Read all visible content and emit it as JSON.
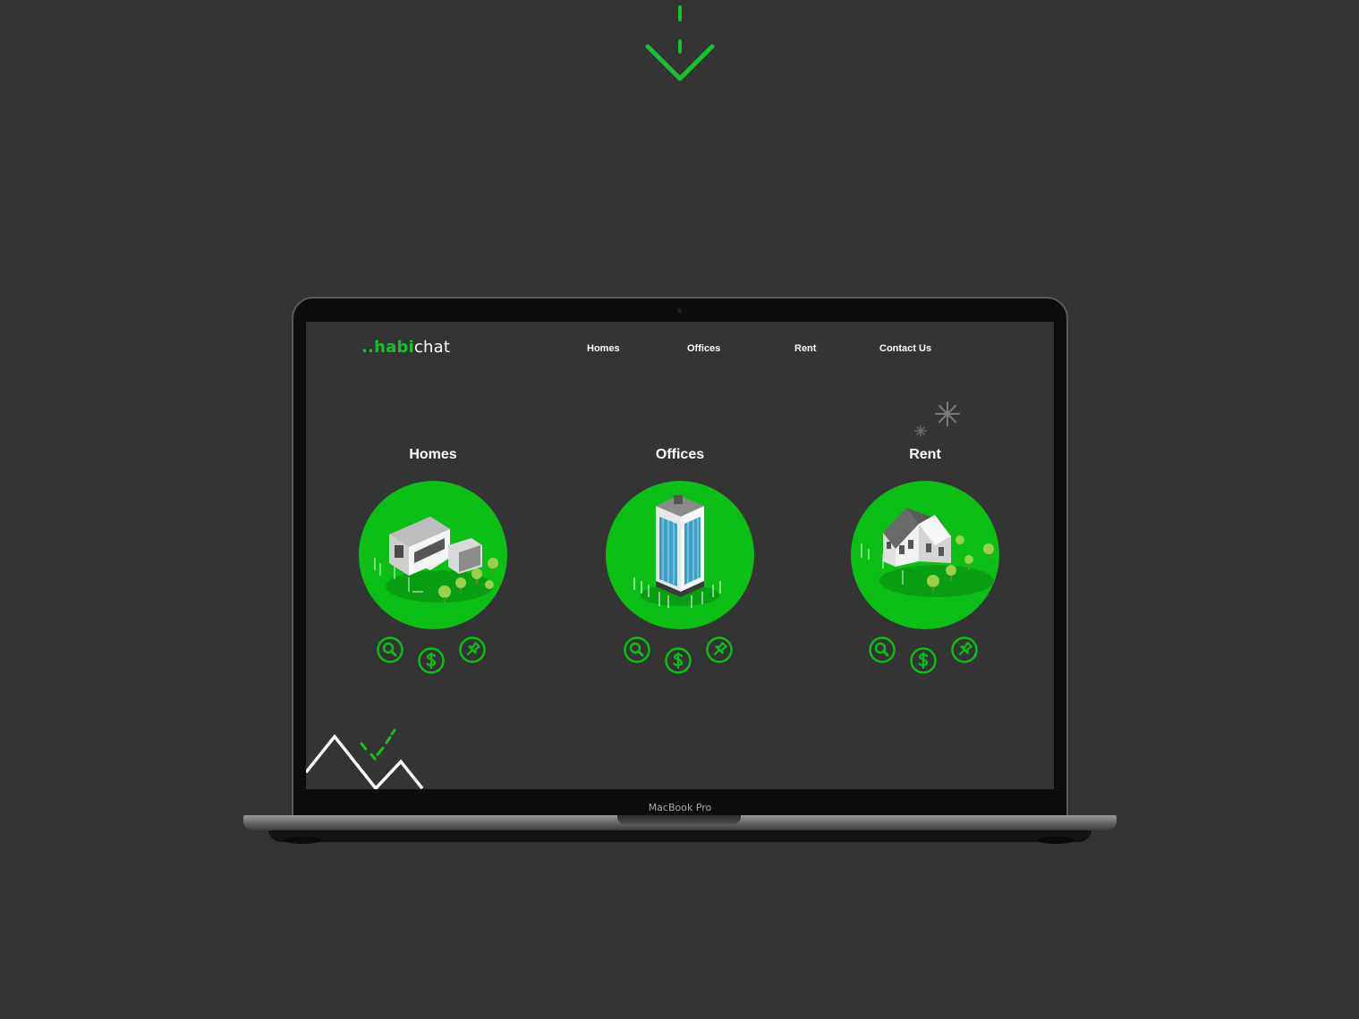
{
  "device": {
    "label": "MacBook Pro"
  },
  "brand": {
    "prefix": "..",
    "part1": "habi",
    "part2": "chat"
  },
  "nav": {
    "items": [
      {
        "label": "Homes"
      },
      {
        "label": "Offices"
      },
      {
        "label": "Rent"
      },
      {
        "label": "Contact Us"
      }
    ]
  },
  "cards": [
    {
      "title": "Homes",
      "icons": [
        "search-icon",
        "dollar-icon",
        "pin-icon"
      ]
    },
    {
      "title": "Offices",
      "icons": [
        "search-icon",
        "dollar-icon",
        "pin-icon"
      ]
    },
    {
      "title": "Rent",
      "icons": [
        "search-icon",
        "dollar-icon",
        "pin-icon"
      ]
    }
  ],
  "colors": {
    "background": "#333333",
    "accent_green": "#0bbf17",
    "text": "#ffffff"
  }
}
